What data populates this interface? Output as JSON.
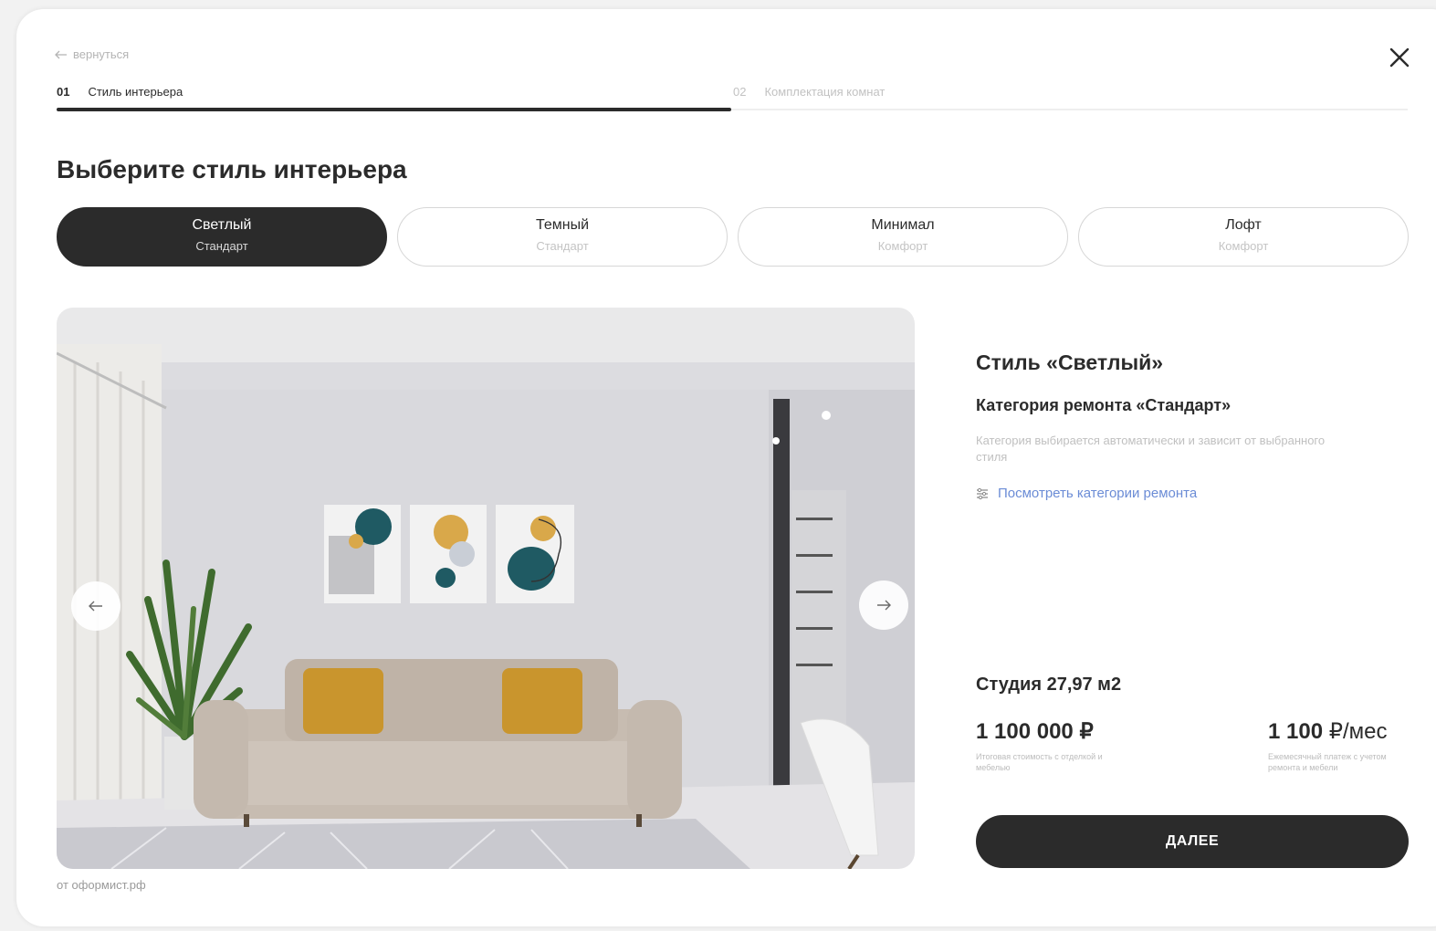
{
  "nav": {
    "back_label": "вернуться"
  },
  "steps": [
    {
      "number": "01",
      "label": "Стиль интерьера",
      "active": true
    },
    {
      "number": "02",
      "label": "Комплектация комнат",
      "active": false
    }
  ],
  "progress": 0.5,
  "heading": "Выберите стиль интерьера",
  "styles": [
    {
      "title": "Светлый",
      "subtitle": "Стандарт",
      "selected": true
    },
    {
      "title": "Темный",
      "subtitle": "Стандарт",
      "selected": false
    },
    {
      "title": "Минимал",
      "subtitle": "Комфорт",
      "selected": false
    },
    {
      "title": "Лофт",
      "subtitle": "Комфорт",
      "selected": false
    }
  ],
  "gallery": {
    "credit": "от оформист.рф"
  },
  "info": {
    "style_title": "Стиль «Светлый»",
    "category_title": "Категория ремонта «Стандарт»",
    "category_desc": "Категория выбирается автоматически и зависит от выбранного стиля",
    "link_label": "Посмотреть категории ремонта",
    "link_color": "#6b8cd6"
  },
  "pricing": {
    "flat": "Студия 27,97 м2",
    "total": "1 100 000 ₽",
    "total_note": "Итоговая стоимость с отделкой и мебелью",
    "monthly_value": "1 100",
    "monthly_unit": "₽/мес",
    "monthly_note": "Ежемесячный платеж с учетом ремонта и мебели"
  },
  "actions": {
    "next_label": "ДАЛЕЕ"
  },
  "colors": {
    "dark": "#2b2b2b",
    "accent_link": "#6b8cd6"
  }
}
